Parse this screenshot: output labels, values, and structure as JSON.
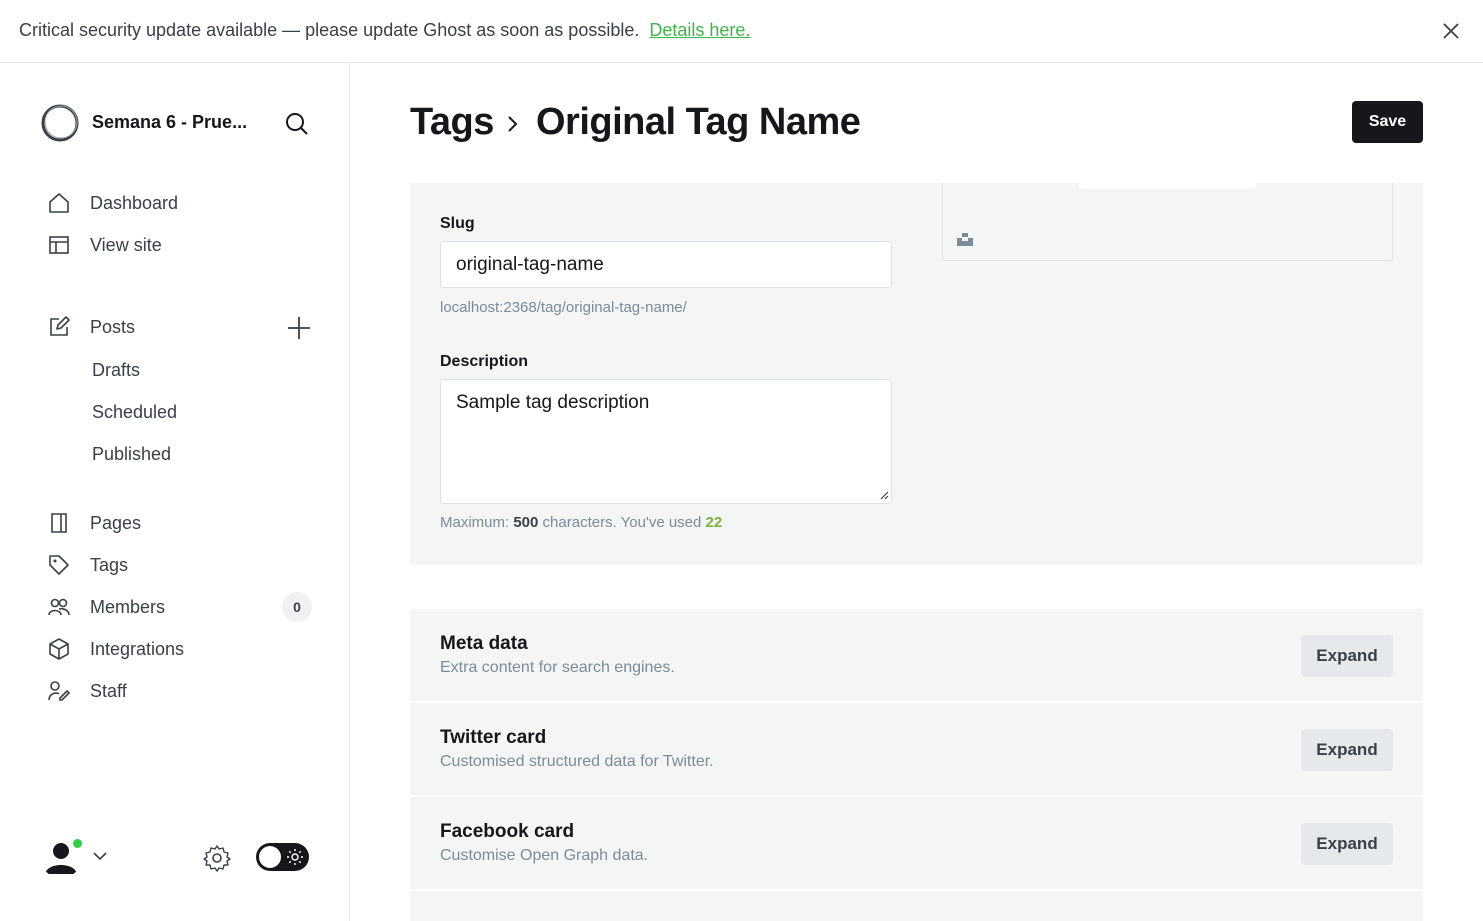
{
  "banner": {
    "text": "Critical security update available — please update Ghost as soon as possible.",
    "link": "Details here."
  },
  "sidebar": {
    "site_title": "Semana 6 - Prue...",
    "nav": [
      {
        "label": "Dashboard",
        "icon": "home-icon"
      },
      {
        "label": "View site",
        "icon": "layout-icon"
      }
    ],
    "posts": {
      "label": "Posts",
      "icon": "edit-icon"
    },
    "post_subitems": [
      "Drafts",
      "Scheduled",
      "Published"
    ],
    "nav2": [
      {
        "label": "Pages",
        "icon": "page-icon"
      },
      {
        "label": "Tags",
        "icon": "tag-icon"
      },
      {
        "label": "Members",
        "icon": "members-icon"
      },
      {
        "label": "Integrations",
        "icon": "cube-icon"
      },
      {
        "label": "Staff",
        "icon": "staff-icon"
      }
    ],
    "members_count": "0"
  },
  "header": {
    "breadcrumb": "Tags",
    "title": "Original Tag Name",
    "save_label": "Save"
  },
  "form": {
    "slug_label": "Slug",
    "slug_value": "original-tag-name",
    "slug_url": "localhost:2368/tag/original-tag-name/",
    "description_label": "Description",
    "description_value": "Sample tag description",
    "hint_prefix": "Maximum:",
    "hint_max": "500",
    "hint_mid": "characters. You've used",
    "hint_used": "22"
  },
  "sections": [
    {
      "title": "Meta data",
      "desc": "Extra content for search engines.",
      "button": "Expand"
    },
    {
      "title": "Twitter card",
      "desc": "Customised structured data for Twitter.",
      "button": "Expand"
    },
    {
      "title": "Facebook card",
      "desc": "Customise Open Graph data.",
      "button": "Expand"
    }
  ],
  "colors": {
    "accent_green": "#30cf43",
    "dark": "#15171a",
    "panel_bg": "#f4f5f5"
  }
}
